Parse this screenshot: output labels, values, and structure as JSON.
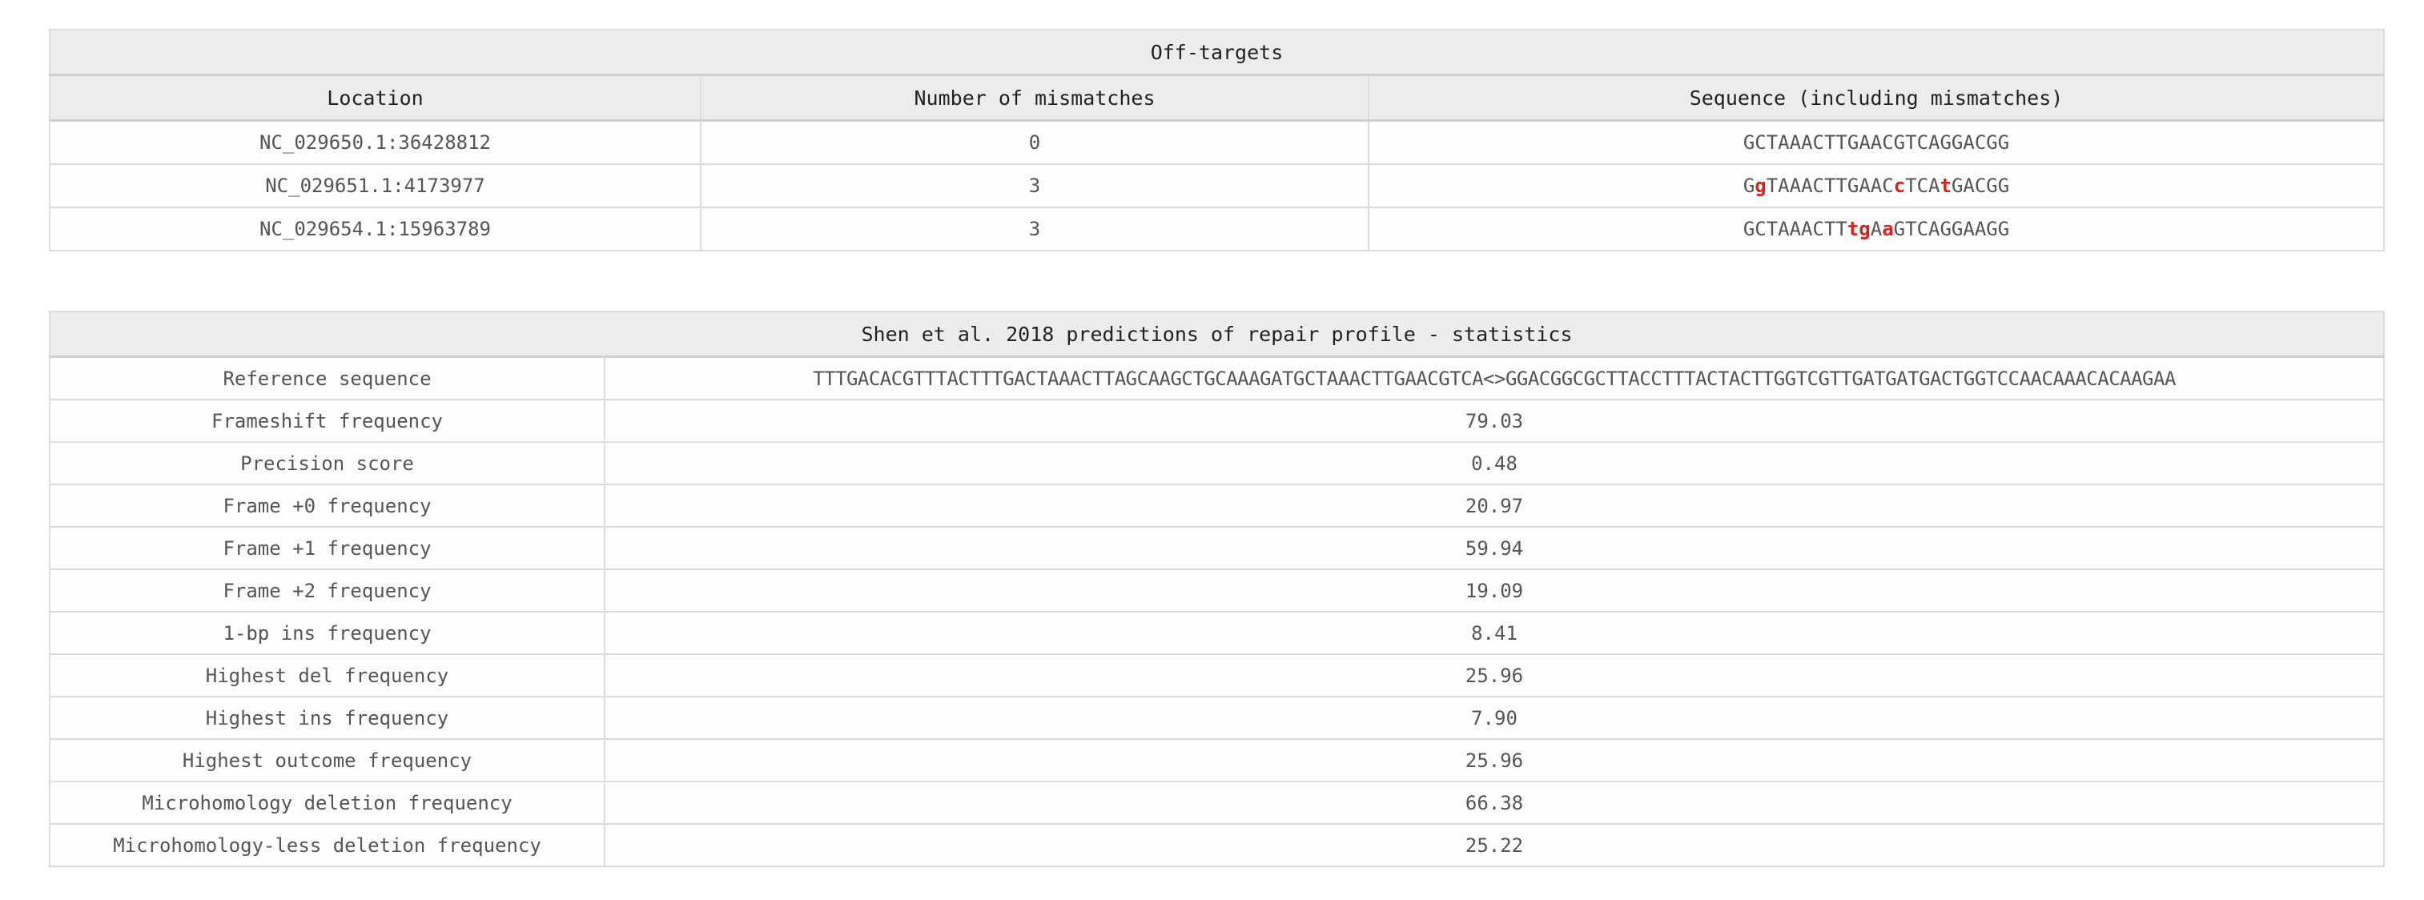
{
  "offtargets": {
    "title": "Off-targets",
    "headers": [
      "Location",
      "Number of mismatches",
      "Sequence (including mismatches)"
    ],
    "rows": [
      {
        "location": "NC_029650.1:36428812",
        "mismatches": "0",
        "sequence": [
          {
            "text": "GCTAAACTTGAACGTCAGGACGG",
            "mismatch": false
          }
        ]
      },
      {
        "location": "NC_029651.1:4173977",
        "mismatches": "3",
        "sequence": [
          {
            "text": "G",
            "mismatch": false
          },
          {
            "text": "g",
            "mismatch": true
          },
          {
            "text": "TAAACTTGAAC",
            "mismatch": false
          },
          {
            "text": "c",
            "mismatch": true
          },
          {
            "text": "TCA",
            "mismatch": false
          },
          {
            "text": "t",
            "mismatch": true
          },
          {
            "text": "GACGG",
            "mismatch": false
          }
        ]
      },
      {
        "location": "NC_029654.1:15963789",
        "mismatches": "3",
        "sequence": [
          {
            "text": "GCTAAACTT",
            "mismatch": false
          },
          {
            "text": "tg",
            "mismatch": true
          },
          {
            "text": "A",
            "mismatch": false
          },
          {
            "text": "a",
            "mismatch": true
          },
          {
            "text": "GTCAGGAAGG",
            "mismatch": false
          }
        ]
      }
    ]
  },
  "shen": {
    "title": "Shen et al. 2018 predictions of repair profile - statistics",
    "rows": [
      {
        "label": "Reference sequence",
        "value": "TTTGACACGTTTACTTTGACTAAACTTAGCAAGCTGCAAAGATGCTAAACTTGAACGTCA<>GGACGGCGCTTACCTTTACTACTTGGTCGTTGATGATGACTGGTCCAACAAACACAAGAA"
      },
      {
        "label": "Frameshift frequency",
        "value": "79.03"
      },
      {
        "label": "Precision score",
        "value": "0.48"
      },
      {
        "label": "Frame +0 frequency",
        "value": "20.97"
      },
      {
        "label": "Frame +1 frequency",
        "value": "59.94"
      },
      {
        "label": "Frame +2 frequency",
        "value": "19.09"
      },
      {
        "label": "1-bp ins frequency",
        "value": "8.41"
      },
      {
        "label": "Highest del frequency",
        "value": "25.96"
      },
      {
        "label": "Highest ins frequency",
        "value": "7.90"
      },
      {
        "label": "Highest outcome frequency",
        "value": "25.96"
      },
      {
        "label": "Microhomology deletion frequency",
        "value": "66.38"
      },
      {
        "label": "Microhomology-less deletion frequency",
        "value": "25.22"
      }
    ]
  },
  "colors": {
    "mismatch": "#e0201c",
    "header_bg": "#ececec",
    "border": "#dcdcdc"
  }
}
